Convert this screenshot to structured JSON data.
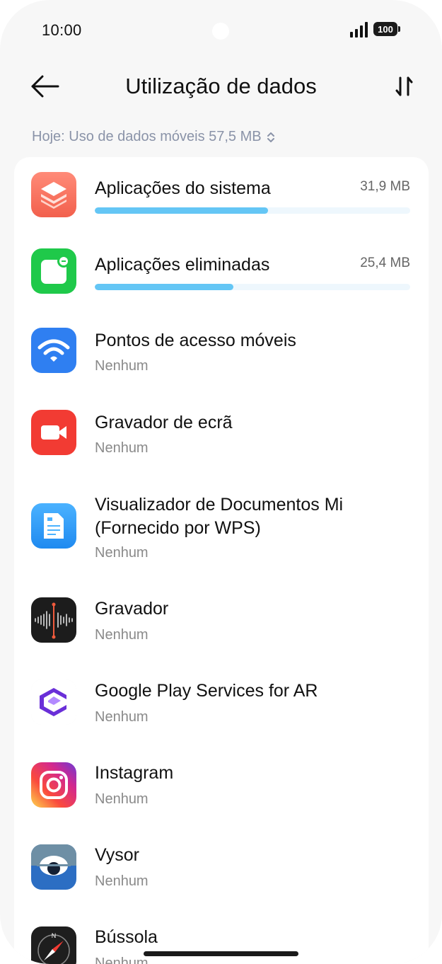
{
  "status_bar": {
    "time": "10:00",
    "battery": "100"
  },
  "header": {
    "title": "Utilização de dados",
    "back_icon": "arrow-left-icon",
    "sort_icon": "sort-icon"
  },
  "period": {
    "label": "Hoje: Uso de dados móveis 57,5 MB",
    "icon": "chevron-up-down-icon"
  },
  "colors": {
    "bar_fill": "#64c6f5",
    "bar_track": "#eef7fd",
    "secondary_text": "#8a93a8"
  },
  "apps": [
    {
      "name": "Aplicações do sistema",
      "size": "31,9 MB",
      "usage_fraction": 0.55,
      "icon": "system-apps-icon"
    },
    {
      "name": "Aplicações eliminadas",
      "size": "25,4 MB",
      "usage_fraction": 0.44,
      "icon": "uninstalled-apps-icon"
    },
    {
      "name": "Pontos de acesso móveis",
      "sub": "Nenhum",
      "icon": "wifi-hotspot-icon"
    },
    {
      "name": "Gravador de ecrã",
      "sub": "Nenhum",
      "icon": "screen-recorder-icon"
    },
    {
      "name": "Visualizador de Documentos Mi (Fornecido por WPS)",
      "sub": "Nenhum",
      "icon": "document-viewer-icon"
    },
    {
      "name": "Gravador",
      "sub": "Nenhum",
      "icon": "sound-recorder-icon"
    },
    {
      "name": "Google Play Services for AR",
      "sub": "Nenhum",
      "icon": "arcore-icon"
    },
    {
      "name": "Instagram",
      "sub": "Nenhum",
      "icon": "instagram-icon"
    },
    {
      "name": "Vysor",
      "sub": "Nenhum",
      "icon": "vysor-icon"
    },
    {
      "name": "Bússola",
      "sub": "Nenhum",
      "icon": "compass-icon"
    }
  ]
}
